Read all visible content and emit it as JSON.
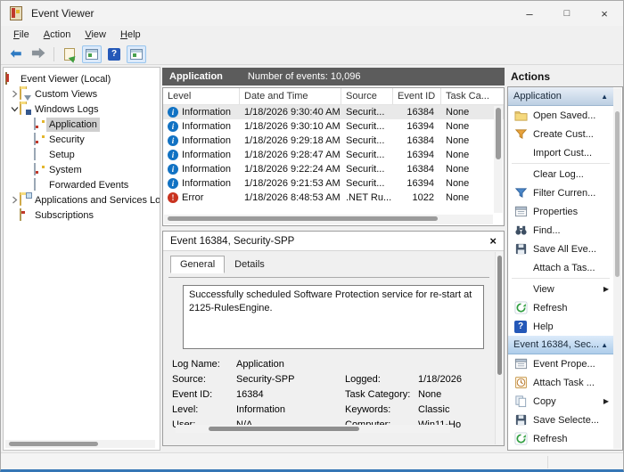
{
  "window": {
    "title": "Event Viewer",
    "controls": {
      "minimize": "–",
      "maximize": "□",
      "close": "×"
    }
  },
  "menu": {
    "items": [
      "File",
      "Action",
      "View",
      "Help"
    ]
  },
  "toolbar": {
    "help_glyph": "?"
  },
  "tree": {
    "items": [
      "Event Viewer (Local)",
      "Custom Views",
      "Windows Logs",
      "Application",
      "Security",
      "Setup",
      "System",
      "Forwarded Events",
      "Applications and Services Log",
      "Subscriptions"
    ]
  },
  "list": {
    "title": "Application",
    "subtitle": "Number of events: 10,096",
    "columns": [
      "Level",
      "Date and Time",
      "Source",
      "Event ID",
      "Task Ca..."
    ],
    "rows": [
      {
        "level": "Information",
        "datetime": "1/18/2026 9:30:40 AM",
        "source": "Securit...",
        "event_id": "16384",
        "task": "None"
      },
      {
        "level": "Information",
        "datetime": "1/18/2026 9:30:10 AM",
        "source": "Securit...",
        "event_id": "16394",
        "task": "None"
      },
      {
        "level": "Information",
        "datetime": "1/18/2026 9:29:18 AM",
        "source": "Securit...",
        "event_id": "16384",
        "task": "None"
      },
      {
        "level": "Information",
        "datetime": "1/18/2026 9:28:47 AM",
        "source": "Securit...",
        "event_id": "16394",
        "task": "None"
      },
      {
        "level": "Information",
        "datetime": "1/18/2026 9:22:24 AM",
        "source": "Securit...",
        "event_id": "16384",
        "task": "None"
      },
      {
        "level": "Information",
        "datetime": "1/18/2026 9:21:53 AM",
        "source": "Securit...",
        "event_id": "16394",
        "task": "None"
      },
      {
        "level": "Error",
        "datetime": "1/18/2026 8:48:53 AM",
        "source": ".NET Ru...",
        "event_id": "1022",
        "task": "None"
      }
    ]
  },
  "preview": {
    "title": "Event 16384, Security-SPP",
    "tabs": [
      "General",
      "Details"
    ],
    "description": "Successfully scheduled Software Protection service for re-start at 2125-RulesEngine.",
    "fields": {
      "log_name_label": "Log Name:",
      "log_name": "Application",
      "source_label": "Source:",
      "source": "Security-SPP",
      "event_id_label": "Event ID:",
      "event_id": "16384",
      "level_label": "Level:",
      "level": "Information",
      "user_label": "User:",
      "user": "N/A",
      "logged_label": "Logged:",
      "logged": "1/18/2026",
      "task_label": "Task Category:",
      "task": "None",
      "keywords_label": "Keywords:",
      "keywords": "Classic",
      "computer_label": "Computer:",
      "computer": "Win11-Ho"
    }
  },
  "actions": {
    "title": "Actions",
    "log_section": {
      "header": "Application",
      "items": [
        "Open Saved...",
        "Create Cust...",
        "Import Cust...",
        "Clear Log...",
        "Filter Curren...",
        "Properties",
        "Find...",
        "Save All Eve...",
        "Attach a Tas...",
        "View",
        "Refresh",
        "Help"
      ]
    },
    "event_section": {
      "header": "Event 16384, Sec...",
      "items": [
        "Event Prope...",
        "Attach Task ...",
        "Copy",
        "Save Selecte...",
        "Refresh"
      ]
    }
  },
  "icons": {
    "info_glyph": "i",
    "error_glyph": "!",
    "collapse_arrow": "▲",
    "submenu_arrow": "▶"
  },
  "colors": {
    "list_header_bg": "#5c5c5c",
    "info_blue": "#1172c3",
    "error_red": "#c9331f",
    "section_selected_blue": "#aecdea",
    "window_accent": "#3576b5"
  }
}
